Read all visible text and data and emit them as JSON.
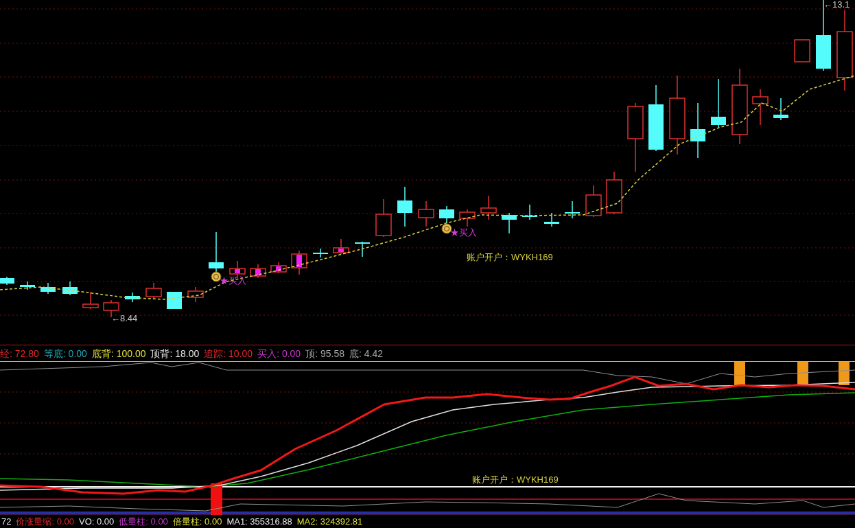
{
  "price_pane": {
    "low_marker": "←8.44",
    "high_marker": "←13.1",
    "buy_signals": [
      {
        "text": "★买入"
      },
      {
        "text": "★买入"
      }
    ],
    "account_text": "账户开户：WYKH169"
  },
  "indicator_legend": [
    {
      "label": "经:",
      "value": "72.80",
      "color": "#e02828"
    },
    {
      "label": "等底:",
      "value": "0.00",
      "color": "#20a8b8"
    },
    {
      "label": "底背:",
      "value": "100.00",
      "color": "#e0e040"
    },
    {
      "label": "顶背:",
      "value": "18.00",
      "color": "#e8e8e8"
    },
    {
      "label": "追踪:",
      "value": "10.00",
      "color": "#e02828"
    },
    {
      "label": "买入:",
      "value": "0.00",
      "color": "#c038c8"
    },
    {
      "label": "顶:",
      "value": "95.58",
      "color": "#a8a8a8"
    },
    {
      "label": "底:",
      "value": "4.42",
      "color": "#a8a8a8"
    }
  ],
  "indicator_pane": {
    "account_text": "账户开户：WYKH169"
  },
  "volume_legend": {
    "leading_value": "72",
    "items": [
      {
        "label": "价涨量缩:",
        "value": "0.00",
        "color": "#e02828"
      },
      {
        "label": "VO:",
        "value": "0.00",
        "color": "#e8e8e8"
      },
      {
        "label": "低量柱:",
        "value": "0.00",
        "color": "#c038c8"
      },
      {
        "label": "倍量柱:",
        "value": "0.00",
        "color": "#e0e040"
      },
      {
        "label": "MA1:",
        "value": "355316.88",
        "color": "#e8e8e8"
      },
      {
        "label": "MA2:",
        "value": "324392.81",
        "color": "#e0e040"
      }
    ]
  }
}
